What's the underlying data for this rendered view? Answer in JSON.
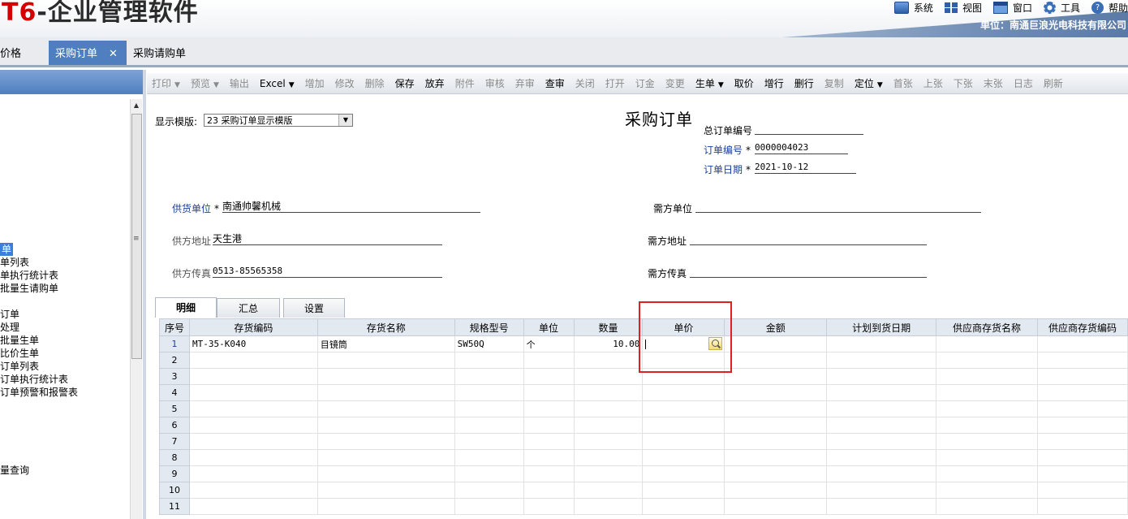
{
  "header": {
    "app_title_letter": "T6",
    "app_title_rest": "-企业管理软件",
    "menu": [
      {
        "label": "系统",
        "icon": "system-icon"
      },
      {
        "label": "视图",
        "icon": "view-icon"
      },
      {
        "label": "窗口",
        "icon": "window-icon"
      },
      {
        "label": "工具",
        "icon": "tools-icon"
      },
      {
        "label": "帮助",
        "icon": "help-icon"
      }
    ],
    "company": "单位：南通巨浪光电科技有限公司"
  },
  "tabs": [
    {
      "label": "价格"
    },
    {
      "label": "采购订单",
      "close": "✕"
    },
    {
      "label": "采购请购单"
    }
  ],
  "leftnav": {
    "items": [
      {
        "label": "单",
        "selected": true
      },
      {
        "label": "单列表"
      },
      {
        "label": "单执行统计表"
      },
      {
        "label": "批量生请购单"
      },
      {
        "label": "订单"
      },
      {
        "label": "处理"
      },
      {
        "label": "批量生单"
      },
      {
        "label": "比价生单"
      },
      {
        "label": "订单列表"
      },
      {
        "label": "订单执行统计表"
      },
      {
        "label": "订单预警和报警表"
      },
      {
        "label": "量查询"
      }
    ],
    "grip": "≡"
  },
  "toolbar": [
    {
      "label": "打印",
      "dd": true,
      "enabled": false
    },
    {
      "label": "预览",
      "dd": true,
      "enabled": false
    },
    {
      "label": "输出",
      "enabled": false
    },
    {
      "label": "Excel",
      "dd": true,
      "enabled": true
    },
    {
      "label": "增加",
      "enabled": false
    },
    {
      "label": "修改",
      "enabled": false
    },
    {
      "label": "删除",
      "enabled": false
    },
    {
      "label": "保存",
      "enabled": true
    },
    {
      "label": "放弃",
      "enabled": true
    },
    {
      "label": "附件",
      "enabled": false
    },
    {
      "label": "审核",
      "enabled": false
    },
    {
      "label": "弃审",
      "enabled": false
    },
    {
      "label": "查审",
      "enabled": true
    },
    {
      "label": "关闭",
      "enabled": false
    },
    {
      "label": "打开",
      "enabled": false
    },
    {
      "label": "订金",
      "enabled": false
    },
    {
      "label": "变更",
      "enabled": false
    },
    {
      "label": "生单",
      "dd": true,
      "enabled": true
    },
    {
      "label": "取价",
      "enabled": true
    },
    {
      "label": "增行",
      "enabled": true
    },
    {
      "label": "删行",
      "enabled": true
    },
    {
      "label": "复制",
      "enabled": false
    },
    {
      "label": "定位",
      "dd": true,
      "enabled": true
    },
    {
      "label": "首张",
      "enabled": false
    },
    {
      "label": "上张",
      "enabled": false
    },
    {
      "label": "下张",
      "enabled": false
    },
    {
      "label": "末张",
      "enabled": false
    },
    {
      "label": "日志",
      "enabled": false
    },
    {
      "label": "刷新",
      "enabled": false
    }
  ],
  "form": {
    "template_label": "显示模版:",
    "template_value": "23 采购订单显示模版",
    "title": "采购订单",
    "master_order_no_label": "总订单编号",
    "order_no_label": "订单编号",
    "order_no": "0000004023",
    "order_date_label": "订单日期",
    "order_date": "2021-10-12",
    "required_mark": "*",
    "supplier_label": "供货单位",
    "supplier": "南通帅馨机械",
    "supplier_addr_label": "供方地址",
    "supplier_addr": "天生港",
    "supplier_fax_label": "供方传真",
    "supplier_fax": "0513-85565358",
    "demand_unit_label": "需方单位",
    "demand_addr_label": "需方地址",
    "demand_fax_label": "需方传真"
  },
  "subtabs": [
    "明细",
    "汇总",
    "设置"
  ],
  "grid": {
    "columns": [
      "序号",
      "存货编码",
      "存货名称",
      "规格型号",
      "单位",
      "数量",
      "单价",
      "金额",
      "计划到货日期",
      "供应商存货名称",
      "供应商存货编码"
    ],
    "rows": [
      {
        "no": "1",
        "code": "MT-35-K040",
        "name": "目镜筒",
        "spec": "SW50Q",
        "unit": "个",
        "qty": "10.00"
      },
      {
        "no": "2"
      },
      {
        "no": "3"
      },
      {
        "no": "4"
      },
      {
        "no": "5"
      },
      {
        "no": "6"
      },
      {
        "no": "7"
      },
      {
        "no": "8"
      },
      {
        "no": "9"
      },
      {
        "no": "10"
      },
      {
        "no": "11"
      }
    ]
  }
}
